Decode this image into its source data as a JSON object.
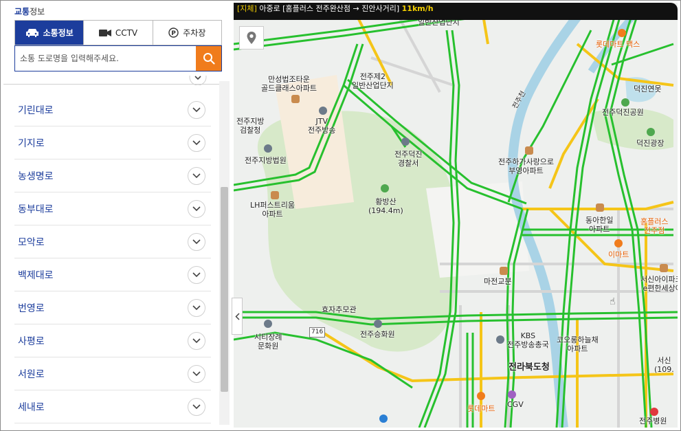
{
  "sidebar": {
    "title_accent": "교통",
    "title_rest": "정보",
    "tabs": [
      {
        "label": "소통정보",
        "icon": "car-icon",
        "active": true
      },
      {
        "label": "CCTV",
        "icon": "camera-icon",
        "active": false
      },
      {
        "label": "주차장",
        "icon": "parking-icon",
        "active": false
      }
    ],
    "search_placeholder": "소통 도로명을 입력해주세요.",
    "roads": [
      "기린대로",
      "기지로",
      "농생명로",
      "동부대로",
      "모악로",
      "백제대로",
      "번영로",
      "사평로",
      "서원로",
      "세내로"
    ]
  },
  "ticker": {
    "status": "[지체]",
    "text": " 아중로 [홈플러스 전주완산점 → 진안사거리] ",
    "speed": "11km/h"
  },
  "map": {
    "labels": [
      {
        "text": "일반산업단지",
        "class": ""
      },
      {
        "text": "롯데마트 맥스",
        "class": "o"
      },
      {
        "text": "만성법조타운\n골드클래스아파트",
        "class": ""
      },
      {
        "text": "전주제2\n일반산업단지",
        "class": ""
      },
      {
        "text": "덕진연못",
        "class": ""
      },
      {
        "text": "전주천",
        "class": ""
      },
      {
        "text": "JTV\n전주방송",
        "class": ""
      },
      {
        "text": "전주지방\n검찰청",
        "class": ""
      },
      {
        "text": "전주덕진공원",
        "class": ""
      },
      {
        "text": "덕진광장",
        "class": ""
      },
      {
        "text": "전주덕진\n경찰서",
        "class": ""
      },
      {
        "text": "전주지방법원",
        "class": ""
      },
      {
        "text": "전주하가사랑으로\n부영아파트",
        "class": ""
      },
      {
        "text": "황방산\n(194.4m)",
        "class": ""
      },
      {
        "text": "LH퍼스트리움\n아파트",
        "class": ""
      },
      {
        "text": "동아한일\n아파트",
        "class": ""
      },
      {
        "text": "홈플러스\n전주점",
        "class": "o"
      },
      {
        "text": "이마트",
        "class": "o"
      },
      {
        "text": "서신아이파크\n e편한세상아",
        "class": ""
      },
      {
        "text": "마전교분",
        "class": ""
      },
      {
        "text": "효자추모관",
        "class": ""
      },
      {
        "text": "시티장례\n문화원",
        "class": ""
      },
      {
        "text": "전주승화원",
        "class": ""
      },
      {
        "text": "KBS\n전주방송총국",
        "class": ""
      },
      {
        "text": "코오롱하늘채\n아파트",
        "class": ""
      },
      {
        "text": "서신\n(109.",
        "class": ""
      },
      {
        "text": "전라북도청",
        "class": "big"
      },
      {
        "text": "롯데마트",
        "class": "o"
      },
      {
        "text": "CGV",
        "class": ""
      },
      {
        "text": "전주병원",
        "class": ""
      },
      {
        "text": "716",
        "class": ""
      }
    ]
  }
}
